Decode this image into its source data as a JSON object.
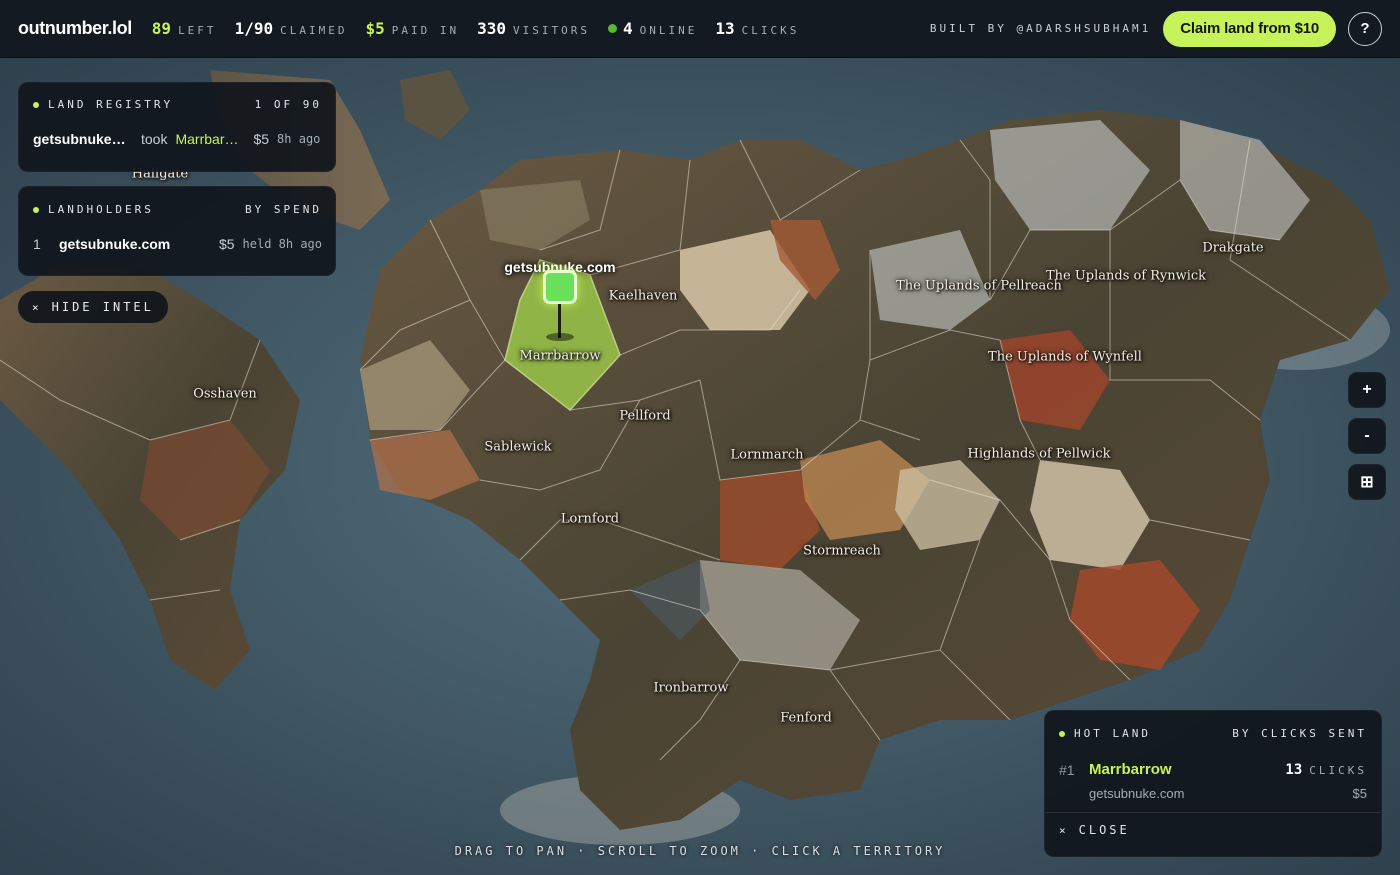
{
  "app": {
    "logo": "outnumber.lol"
  },
  "stats": {
    "left_num": "89",
    "left_label": "LEFT",
    "claimed_num": "1/90",
    "claimed_label": "CLAIMED",
    "paid_num": "$5",
    "paid_label": "PAID IN",
    "visitors_num": "330",
    "visitors_label": "VISITORS",
    "online_num": "4",
    "online_label": "ONLINE",
    "clicks_num": "13",
    "clicks_label": "CLICKS"
  },
  "header": {
    "built_by": "BUILT BY @ADARSHSUBHAM1",
    "claim_label": "Claim land from $10",
    "help_label": "?"
  },
  "registry": {
    "title": "LAND REGISTRY",
    "count": "1 OF 90",
    "entry": {
      "who": "getsubnuke.com",
      "verb": "took",
      "land": "Marrbarrow",
      "price": "$5",
      "ago": "8h ago"
    }
  },
  "holders": {
    "title": "LANDHOLDERS",
    "sort": "BY SPEND",
    "entry": {
      "rank": "1",
      "who": "getsubnuke.com",
      "price": "$5",
      "held": "held 8h ago"
    }
  },
  "hide_intel": {
    "x": "×",
    "label": "HIDE INTEL"
  },
  "hotland": {
    "title": "HOT LAND",
    "sort": "BY CLICKS SENT",
    "entry": {
      "rank": "#1",
      "land": "Marrbarrow",
      "clicks": "13",
      "clicks_label": "CLICKS",
      "owner": "getsubnuke.com",
      "price": "$5"
    },
    "close_x": "×",
    "close_label": "CLOSE"
  },
  "controls": {
    "zoom_in": "+",
    "zoom_out": "-",
    "fit": "⊞"
  },
  "hint": "DRAG TO PAN · SCROLL TO ZOOM · CLICK A TERRITORY",
  "map": {
    "claimed_marker_label": "getsubnuke.com",
    "places": {
      "marrbarrow": "Marrbarrow",
      "kaelhaven": "Kaelhaven",
      "pellford": "Pellford",
      "sablewick": "Sablewick",
      "lornford": "Lornford",
      "lornmarch": "Lornmarch",
      "stormreach": "Stormreach",
      "ironbarrow": "Ironbarrow",
      "fenford": "Fenford",
      "osshaven": "Osshaven",
      "hallgate": "Hallgate",
      "drakgate": "Drakgate",
      "uplands_pellreach": "The Uplands of Pellreach",
      "uplands_rynwick": "The Uplands of Rynwick",
      "uplands_wynfell": "The Uplands of Wynfell",
      "highlands_pellwick": "Highlands of Pellwick"
    }
  },
  "colors": {
    "accent": "#c7f25a",
    "online": "#58b935",
    "panel": "#10161c",
    "sea": "#4a6270"
  }
}
